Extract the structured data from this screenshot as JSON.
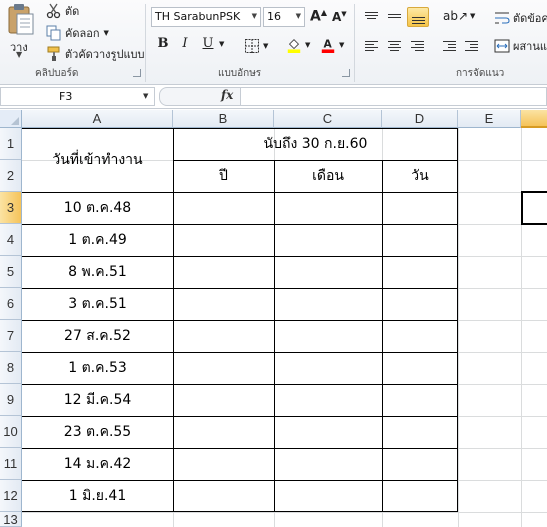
{
  "ribbon": {
    "clipboard": {
      "paste_label": "วาง",
      "cut_label": "ตัด",
      "copy_label": "คัดลอก",
      "format_painter_label": "ตัวคัดวางรูปแบบ",
      "group_label": "คลิปบอร์ด"
    },
    "font": {
      "font_name": "TH SarabunPSK",
      "font_size": "16",
      "bold": "B",
      "italic": "I",
      "underline": "U",
      "group_label": "แบบอักษร",
      "font_color": "#ff0000",
      "fill_color": "#ffff00"
    },
    "alignment": {
      "wrap_text_label": "ตัดข้อค",
      "merge_label": "ผสานแ",
      "group_label": "การจัดแนว"
    }
  },
  "formula_bar": {
    "name_box": "F3",
    "fx": "fx",
    "formula": ""
  },
  "grid": {
    "columns": [
      "A",
      "B",
      "C",
      "D",
      "E"
    ],
    "rows": [
      "1",
      "2",
      "3",
      "4",
      "5",
      "6",
      "7",
      "8",
      "9",
      "10",
      "11",
      "12",
      "13"
    ],
    "selected_column": "F",
    "selected_row": "3",
    "header_a": "วันที่เข้าทำงาน",
    "header_bcd": "นับถึง 30 ก.ย.60",
    "sub_b": "ปี",
    "sub_c": "เดือน",
    "sub_d": "วัน",
    "dates": [
      "10 ต.ค.48",
      "1 ต.ค.49",
      "8 พ.ค.51",
      "3 ต.ค.51",
      "27 ส.ค.52",
      "1 ต.ค.53",
      "12 มี.ค.54",
      "23 ต.ค.55",
      "14 ม.ค.42",
      "1 มิ.ย.41"
    ]
  },
  "colors": {
    "selected_header": "#f5c35a",
    "header_bg": "#e3eaf3",
    "gridline": "#dadcdd"
  }
}
